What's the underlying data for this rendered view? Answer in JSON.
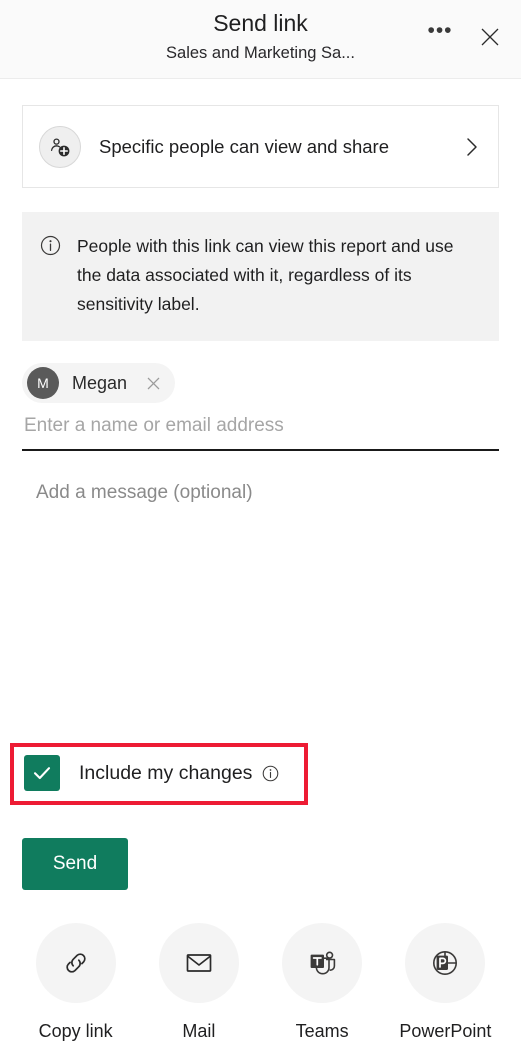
{
  "header": {
    "title": "Send link",
    "subtitle": "Sales and Marketing Sa...",
    "more_options_label": "•••",
    "more_options_name": "more-options",
    "close_name": "close"
  },
  "permission": {
    "label": "Specific people can view and share",
    "icon": "people-add-icon",
    "chevron": "chevron-right-icon"
  },
  "info_banner": {
    "icon": "info-icon",
    "text": "People with this link can view this report and use the data associated with it, regardless of its sensitivity label."
  },
  "recipients": {
    "chips": [
      {
        "name": "Megan",
        "initial": "M",
        "remove_label": "Remove Megan"
      }
    ],
    "input_value": "",
    "input_placeholder": "Enter a name or email address"
  },
  "message": {
    "value": "",
    "placeholder": "Add a message (optional)"
  },
  "include_changes": {
    "label": "Include my changes",
    "checked": true,
    "info_icon": "info-icon",
    "highlight_color": "#ed1b34"
  },
  "send": {
    "label": "Send"
  },
  "actions": [
    {
      "label": "Copy link",
      "icon": "link-icon"
    },
    {
      "label": "Mail",
      "icon": "mail-icon"
    },
    {
      "label": "Teams",
      "icon": "teams-icon"
    },
    {
      "label": "PowerPoint",
      "icon": "powerpoint-icon"
    }
  ],
  "colors": {
    "accent": "#107c5e",
    "highlight": "#ed1b34",
    "header_bg": "#fafafa",
    "banner_bg": "#f2f2f2",
    "avatar_bg": "#5a5a5a"
  }
}
